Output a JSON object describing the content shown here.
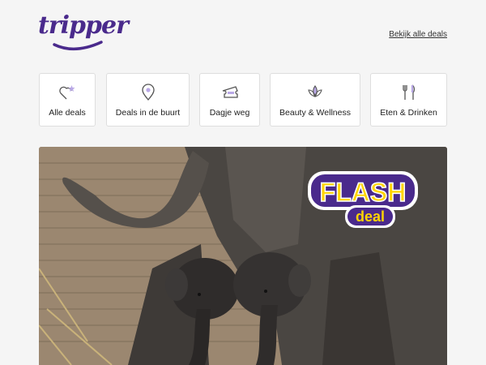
{
  "brand": {
    "logo_text": "tripper",
    "color": "#4a2a8c"
  },
  "header": {
    "all_deals_link": "Bekijk alle deals"
  },
  "categories": [
    {
      "label": "Alle deals",
      "icon": "heart-star-icon"
    },
    {
      "label": "Deals in de buurt",
      "icon": "location-pin-icon"
    },
    {
      "label": "Dagje weg",
      "icon": "ticket-icon"
    },
    {
      "label": "Beauty & Wellness",
      "icon": "lotus-icon"
    },
    {
      "label": "Eten & Drinken",
      "icon": "fork-knife-icon"
    }
  ],
  "hero": {
    "badge_title": "FLASH",
    "badge_subtitle": "deal",
    "badge_colors": {
      "primary": "#4a2a8c",
      "accent": "#ffd400"
    }
  }
}
